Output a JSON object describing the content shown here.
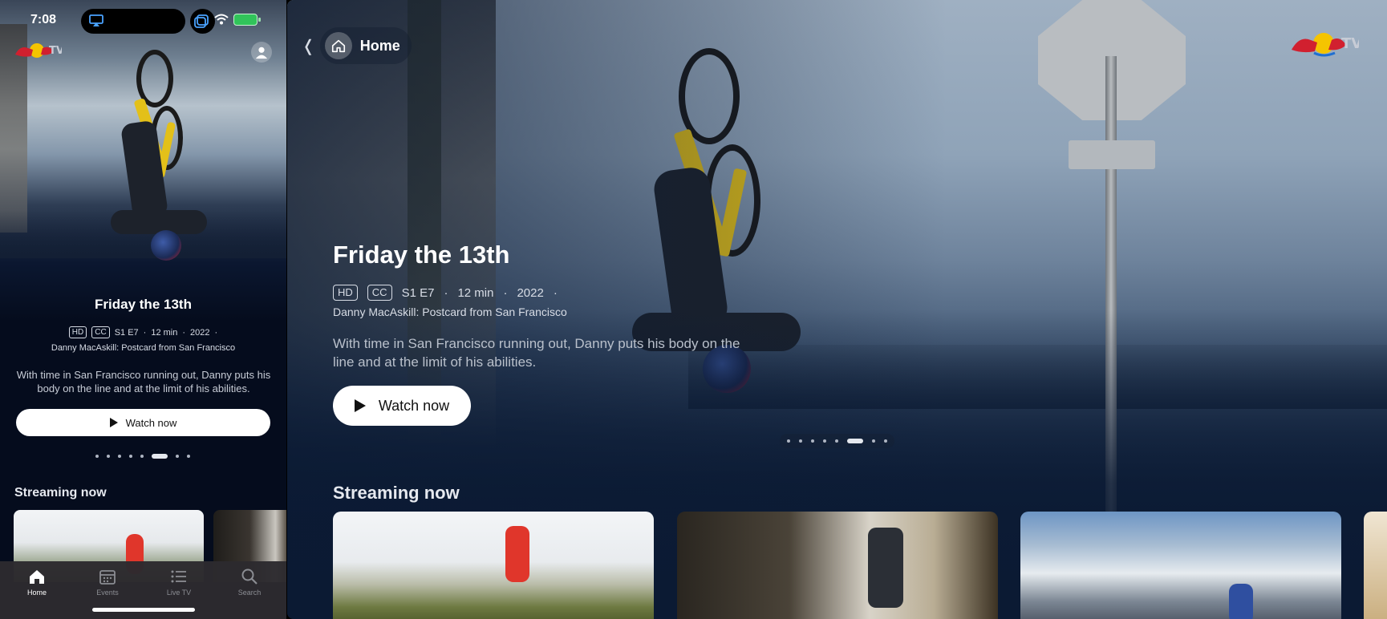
{
  "phone": {
    "status": {
      "time": "7:08"
    },
    "hero": {
      "title": "Friday the 13th",
      "badges": [
        "HD",
        "CC"
      ],
      "episode": "S1 E7",
      "duration": "12 min",
      "year": "2022",
      "series": "Danny MacAskill: Postcard from San Francisco",
      "description": "With time in San Francisco running out, Danny puts his body on the line and at the limit of his abilities.",
      "watch_label": "Watch now"
    },
    "pager": {
      "count": 8,
      "active_index": 5
    },
    "section_title": "Streaming now",
    "tabs": [
      {
        "label": "Home",
        "icon": "home-icon",
        "active": true
      },
      {
        "label": "Events",
        "icon": "calendar-icon",
        "active": false
      },
      {
        "label": "Live TV",
        "icon": "list-icon",
        "active": false
      },
      {
        "label": "Search",
        "icon": "search-icon",
        "active": false
      }
    ]
  },
  "tv": {
    "nav": {
      "back_icon": "chevron-left-icon",
      "home_label": "Home"
    },
    "hero": {
      "title": "Friday the 13th",
      "badges": [
        "HD",
        "CC"
      ],
      "episode": "S1 E7",
      "duration": "12 min",
      "year": "2022",
      "series": "Danny MacAskill: Postcard from San Francisco",
      "description": "With time in San Francisco running out, Danny puts his body on the line and at the limit of his abilities.",
      "watch_label": "Watch now"
    },
    "pager": {
      "count": 8,
      "active_index": 5
    },
    "section_title": "Streaming now"
  },
  "colors": {
    "background": "#0b1a33",
    "button": "#ffffff",
    "battery": "#31c45a",
    "brand_red": "#d1202f",
    "brand_yellow": "#f5c400"
  }
}
